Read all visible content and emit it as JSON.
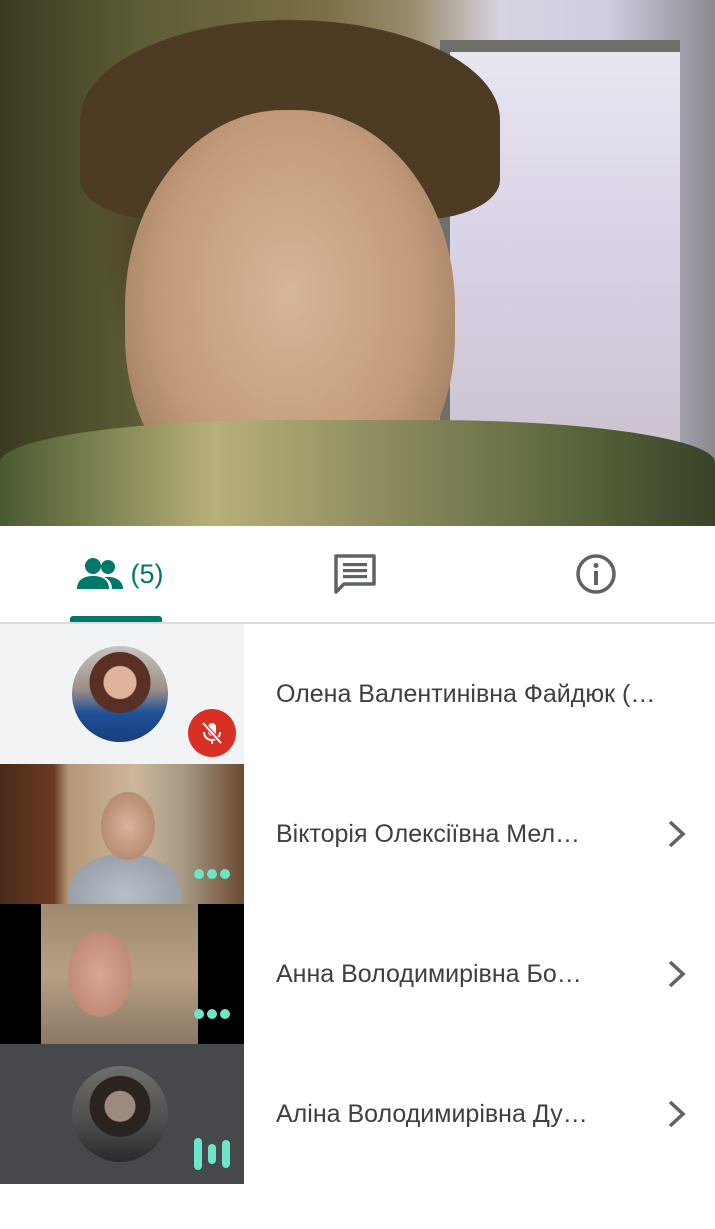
{
  "tabs": {
    "people_count": "(5)"
  },
  "participants": [
    {
      "name": "Олена Валентинівна Файдюк (…",
      "mic": "muted"
    },
    {
      "name": "Вікторія Олексіївна Мел…"
    },
    {
      "name": "Анна Володимирівна Бо…"
    },
    {
      "name": "Аліна Володимирівна Ду…",
      "speaking": true
    }
  ],
  "colors": {
    "accent": "#00796b",
    "muted_badge": "#d93025",
    "activity_indicator": "#6be6c8",
    "text": "#3c4043"
  },
  "icons": {
    "people_tab": "people-icon",
    "chat_tab": "chat-icon",
    "info_tab": "info-icon",
    "mute": "mic-off-icon",
    "more": "more-dots-icon",
    "row_action": "chevron-right-icon",
    "speaking": "audio-level-icon"
  }
}
